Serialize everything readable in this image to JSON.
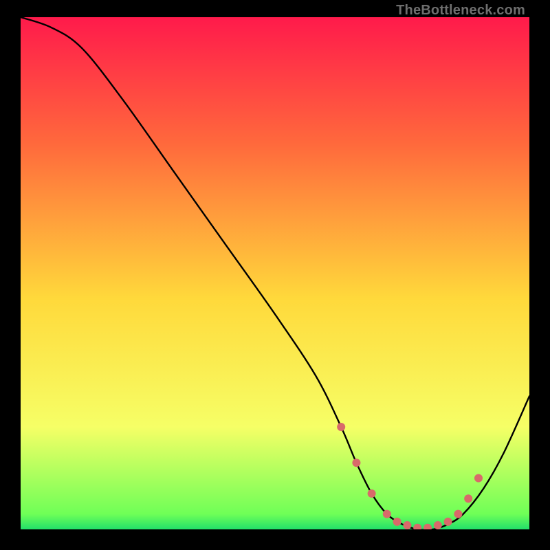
{
  "watermark": "TheBottleneck.com",
  "chart_data": {
    "type": "line",
    "title": "",
    "xlabel": "",
    "ylabel": "",
    "xlim": [
      0,
      100
    ],
    "ylim": [
      0,
      100
    ],
    "gradient_stops": [
      {
        "offset": 0,
        "color": "#ff1a4b"
      },
      {
        "offset": 25,
        "color": "#ff6a3c"
      },
      {
        "offset": 55,
        "color": "#ffd93b"
      },
      {
        "offset": 80,
        "color": "#f6ff66"
      },
      {
        "offset": 97,
        "color": "#6fff57"
      },
      {
        "offset": 100,
        "color": "#22e06a"
      }
    ],
    "series": [
      {
        "name": "bottleneck-curve",
        "color": "#000000",
        "x": [
          0,
          6,
          12,
          20,
          30,
          40,
          50,
          58,
          63,
          66,
          69,
          72,
          75,
          78,
          81,
          84,
          87,
          91,
          95,
          100
        ],
        "values": [
          100,
          98,
          94,
          84,
          70,
          56,
          42,
          30,
          20,
          13,
          7,
          3,
          1,
          0,
          0,
          1,
          3,
          8,
          15,
          26
        ]
      }
    ],
    "optimal_marker": {
      "color": "#d86a6a",
      "radius": 6,
      "x": [
        63,
        66,
        69,
        72,
        74,
        76,
        78,
        80,
        82,
        84,
        86,
        88,
        90
      ],
      "values": [
        20,
        13,
        7,
        3,
        1.5,
        0.8,
        0.3,
        0.3,
        0.8,
        1.5,
        3,
        6,
        10
      ]
    }
  }
}
